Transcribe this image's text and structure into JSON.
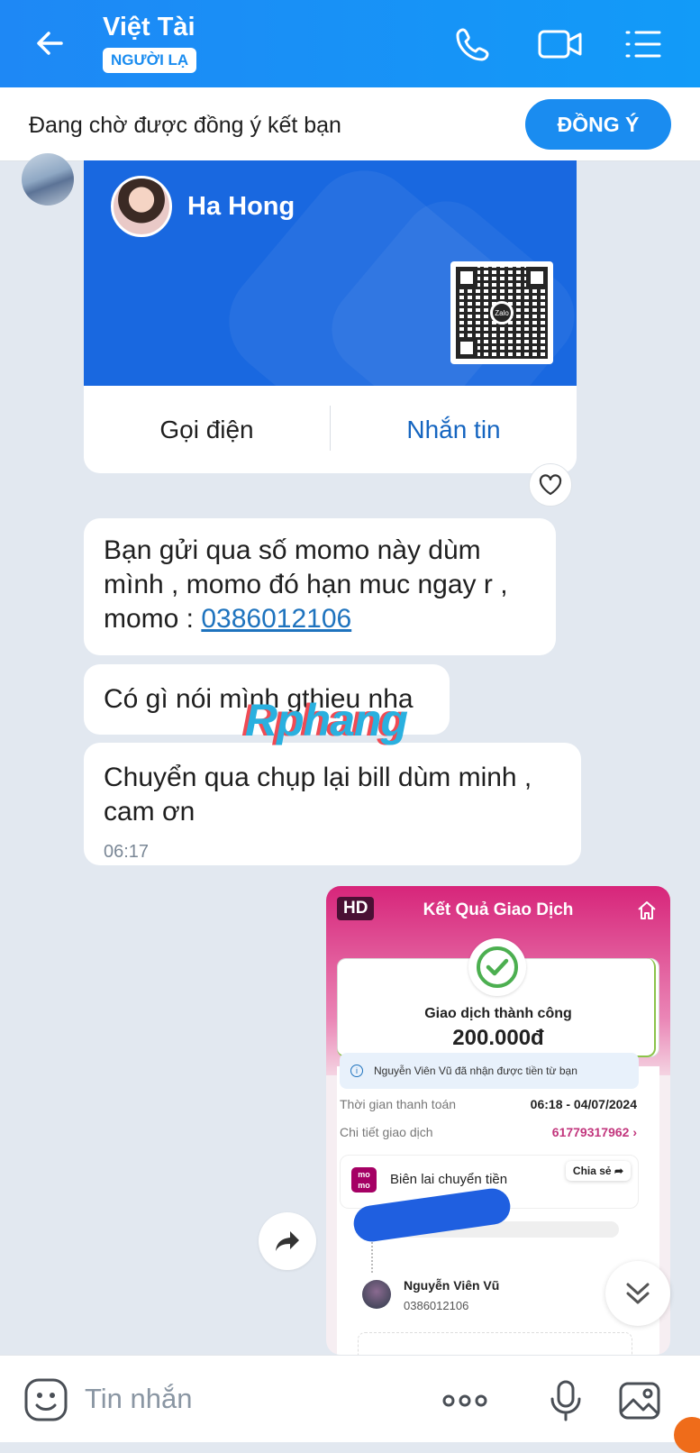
{
  "header": {
    "title": "Việt Tài",
    "badge": "NGƯỜI LẠ",
    "icons": [
      "back-arrow-icon",
      "phone-icon",
      "video-call-icon",
      "menu-icon"
    ]
  },
  "friend_request": {
    "text": "Đang chờ được đồng ý kết bạn",
    "button": "ĐỒNG Ý"
  },
  "contact_card": {
    "name": "Ha Hong",
    "qr_logo": "Zalo",
    "call_label": "Gọi điện",
    "message_label": "Nhắn tin"
  },
  "messages": [
    {
      "text_before_link": "Bạn gửi qua số momo này dùm mình , momo đó hạn muc ngay r , momo : ",
      "link": "0386012106"
    },
    {
      "text": "Có gì nói mình gthieu nha"
    },
    {
      "text": "Chuyển qua chụp lại bill dùm minh , cam ơn",
      "time": "06:17"
    }
  ],
  "watermark": "Rphang",
  "receipt": {
    "hd": "HD",
    "title": "Kết Quả Giao Dịch",
    "status": "Giao dịch thành công",
    "amount": "200.000đ",
    "notice": "Nguyễn Viên Vũ đã nhận được tiền từ bạn",
    "time_label": "Thời gian thanh toán",
    "time_value": "06:18 - 04/07/2024",
    "detail_label": "Chi tiết giao dịch",
    "detail_value": "61779317962",
    "logo": "mo mo",
    "receipt_title": "Biên lai chuyển tiền",
    "share": "Chia sẻ",
    "recipient_name": "Nguyễn Viên Vũ",
    "recipient_phone": "0386012106"
  },
  "composer": {
    "placeholder": "Tin nhắn",
    "icons": [
      "emoji-icon",
      "more-icon",
      "microphone-icon",
      "image-icon"
    ]
  },
  "colors": {
    "header_blue": "#1e88f5",
    "card_blue": "#1968e0",
    "momo_pink": "#d7257a",
    "link": "#1e73be"
  }
}
